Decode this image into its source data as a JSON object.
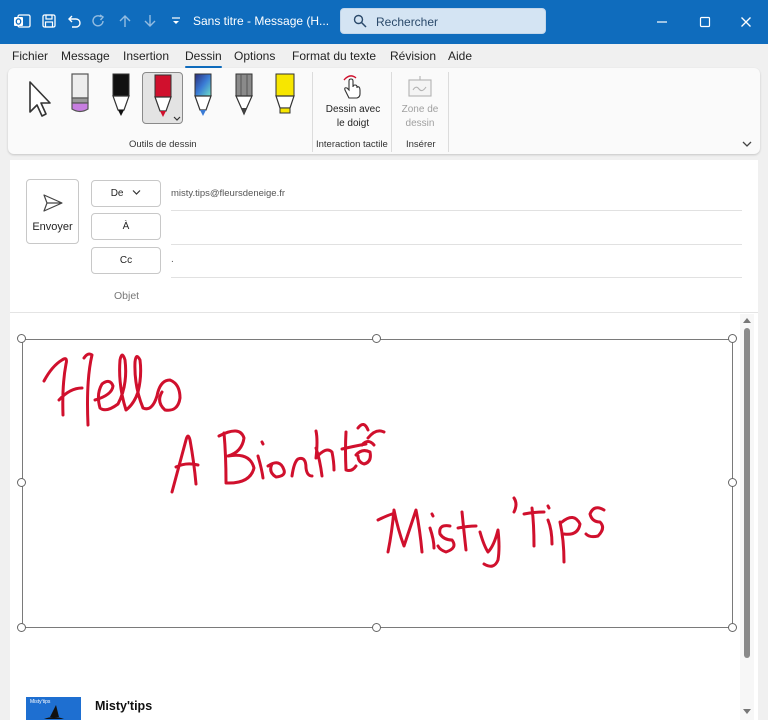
{
  "titlebar": {
    "title": "Sans titre  -  Message (H...",
    "search_placeholder": "Rechercher"
  },
  "menu": {
    "tabs": [
      "Fichier",
      "Message",
      "Insertion",
      "Dessin",
      "Options",
      "Format du texte",
      "Révision",
      "Aide"
    ],
    "active": "Dessin"
  },
  "ribbon": {
    "groups": {
      "drawing_tools": "Outils de dessin",
      "touch": "Interaction tactile",
      "insert": "Insérer"
    },
    "draw_with_finger": "Dessin avec\nle doigt",
    "draw_with_finger_l1": "Dessin avec",
    "draw_with_finger_l2": "le doigt",
    "drawing_zone_l1": "Zone de",
    "drawing_zone_l2": "dessin",
    "tools": [
      "select-arrow",
      "eraser",
      "black-pen",
      "red-pen",
      "galaxy-pen",
      "pencil",
      "highlighter-yellow"
    ],
    "selected_tool": "red-pen"
  },
  "compose": {
    "send_label": "Envoyer",
    "from_button": "De",
    "from_value": "misty.tips@fleursdeneige.fr",
    "to_button": "À",
    "cc_button": "Cc",
    "cc_value": ".",
    "subject_label": "Objet"
  },
  "canvas": {
    "ink_color": "#d0102d",
    "ink_texts": [
      "Hello",
      "A Bientôt",
      "Misty' tips"
    ]
  },
  "signature": {
    "name": "Misty'tips",
    "image_text": "Misty'tips"
  },
  "colors": {
    "titlebar": "#0f6cbd",
    "accent": "#0f6cbd",
    "ink": "#d0102d",
    "highlighter": "#f7e600"
  }
}
